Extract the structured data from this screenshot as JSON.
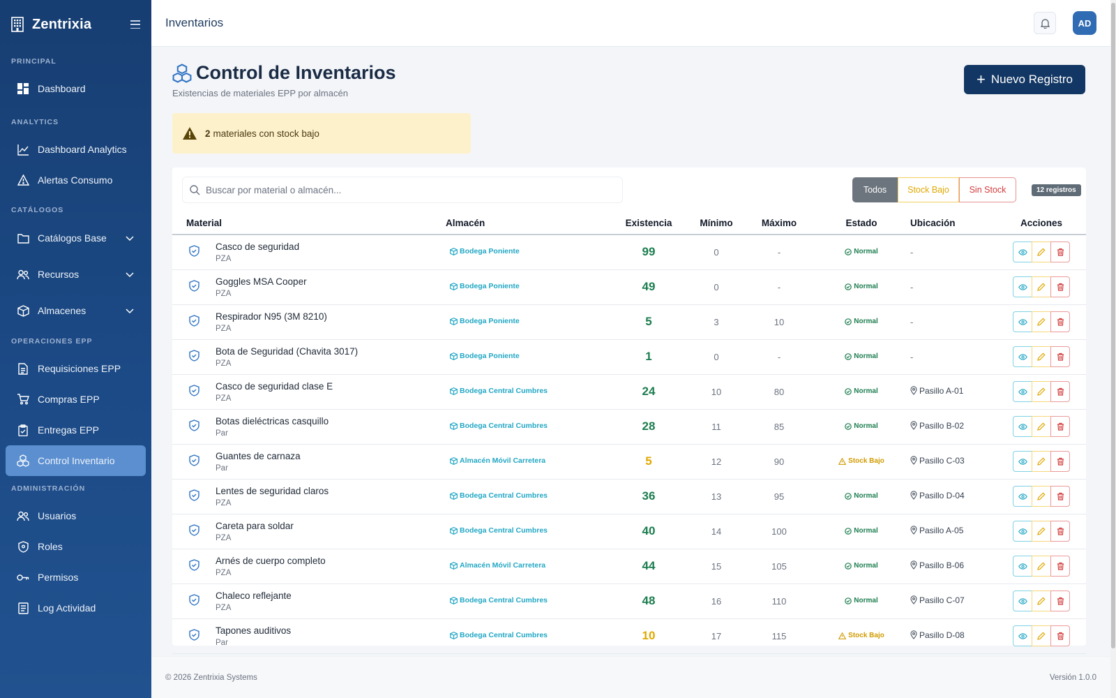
{
  "sidebar": {
    "brand": "Zentrixia",
    "sections": {
      "principal": "PRINCIPAL",
      "analytics": "ANALYTICS",
      "catalogos": "CATÁLOGOS",
      "operaciones": "OPERACIONES EPP",
      "administracion": "ADMINISTRACIÓN"
    },
    "items": {
      "dashboard": "Dashboard",
      "dashboard_analytics": "Dashboard Analytics",
      "alertas_consumo": "Alertas Consumo",
      "catalogos_base": "Catálogos Base",
      "recursos": "Recursos",
      "almacenes": "Almacenes",
      "requisiciones": "Requisiciones EPP",
      "compras": "Compras EPP",
      "entregas": "Entregas EPP",
      "control_inventario": "Control Inventario",
      "usuarios": "Usuarios",
      "roles": "Roles",
      "permisos": "Permisos",
      "log_actividad": "Log Actividad"
    },
    "active_item": "control_inventario"
  },
  "header": {
    "title": "Inventarios",
    "avatar_initials": "AD"
  },
  "page": {
    "title": "Control de Inventarios",
    "subtitle": "Existencias de materiales EPP por almacén",
    "new_button": "Nuevo Registro",
    "alert": {
      "count": "2",
      "text": "materiales con stock bajo"
    }
  },
  "toolbar": {
    "search_placeholder": "Buscar por material o almacén...",
    "filters": {
      "all": "Todos",
      "low": "Stock Bajo",
      "none": "Sin Stock"
    },
    "records_badge": "12 registros"
  },
  "table": {
    "headers": {
      "material": "Material",
      "almacen": "Almacén",
      "existencia": "Existencia",
      "minimo": "Mínimo",
      "maximo": "Máximo",
      "estado": "Estado",
      "ubicacion": "Ubicación",
      "acciones": "Acciones"
    },
    "rows": [
      {
        "material": "Casco de seguridad",
        "unidad": "PZA",
        "almacen": "Bodega Poniente",
        "existencia": "99",
        "minimo": "0",
        "maximo": "-",
        "estado": "Normal",
        "estado_tipo": "normal",
        "ubicacion": "-"
      },
      {
        "material": "Goggles MSA Cooper",
        "unidad": "PZA",
        "almacen": "Bodega Poniente",
        "existencia": "49",
        "minimo": "0",
        "maximo": "-",
        "estado": "Normal",
        "estado_tipo": "normal",
        "ubicacion": "-"
      },
      {
        "material": "Respirador N95 (3M 8210)",
        "unidad": "PZA",
        "almacen": "Bodega Poniente",
        "existencia": "5",
        "minimo": "3",
        "maximo": "10",
        "estado": "Normal",
        "estado_tipo": "normal",
        "ubicacion": "-"
      },
      {
        "material": "Bota de Seguridad (Chavita 3017)",
        "unidad": "PZA",
        "almacen": "Bodega Poniente",
        "existencia": "1",
        "minimo": "0",
        "maximo": "-",
        "estado": "Normal",
        "estado_tipo": "normal",
        "ubicacion": "-"
      },
      {
        "material": "Casco de seguridad clase E",
        "unidad": "PZA",
        "almacen": "Bodega Central Cumbres",
        "existencia": "24",
        "minimo": "10",
        "maximo": "80",
        "estado": "Normal",
        "estado_tipo": "normal",
        "ubicacion": "Pasillo A-01"
      },
      {
        "material": "Botas dieléctricas casquillo",
        "unidad": "Par",
        "almacen": "Bodega Central Cumbres",
        "existencia": "28",
        "minimo": "11",
        "maximo": "85",
        "estado": "Normal",
        "estado_tipo": "normal",
        "ubicacion": "Pasillo B-02"
      },
      {
        "material": "Guantes de carnaza",
        "unidad": "Par",
        "almacen": "Almacén Móvil Carretera",
        "existencia": "5",
        "minimo": "12",
        "maximo": "90",
        "estado": "Stock Bajo",
        "estado_tipo": "low",
        "ubicacion": "Pasillo C-03"
      },
      {
        "material": "Lentes de seguridad claros",
        "unidad": "PZA",
        "almacen": "Bodega Central Cumbres",
        "existencia": "36",
        "minimo": "13",
        "maximo": "95",
        "estado": "Normal",
        "estado_tipo": "normal",
        "ubicacion": "Pasillo D-04"
      },
      {
        "material": "Careta para soldar",
        "unidad": "PZA",
        "almacen": "Bodega Central Cumbres",
        "existencia": "40",
        "minimo": "14",
        "maximo": "100",
        "estado": "Normal",
        "estado_tipo": "normal",
        "ubicacion": "Pasillo A-05"
      },
      {
        "material": "Arnés de cuerpo completo",
        "unidad": "PZA",
        "almacen": "Almacén Móvil Carretera",
        "existencia": "44",
        "minimo": "15",
        "maximo": "105",
        "estado": "Normal",
        "estado_tipo": "normal",
        "ubicacion": "Pasillo B-06"
      },
      {
        "material": "Chaleco reflejante",
        "unidad": "PZA",
        "almacen": "Bodega Central Cumbres",
        "existencia": "48",
        "minimo": "16",
        "maximo": "110",
        "estado": "Normal",
        "estado_tipo": "normal",
        "ubicacion": "Pasillo C-07"
      },
      {
        "material": "Tapones auditivos",
        "unidad": "Par",
        "almacen": "Bodega Central Cumbres",
        "existencia": "10",
        "minimo": "17",
        "maximo": "115",
        "estado": "Stock Bajo",
        "estado_tipo": "low",
        "ubicacion": "Pasillo D-08"
      }
    ]
  },
  "footer": {
    "copyright": "© 2026 Zentrixia Systems",
    "version": "Versión 1.0.0"
  },
  "colors": {
    "sidebar": "#173e72",
    "active": "#5b8fd0",
    "primary_button": "#133764",
    "ok": "#1c7d4f",
    "low": "#e0a800",
    "danger": "#d33b3b",
    "info": "#22a7c4"
  },
  "icons": {
    "dashboard": "grid-icon",
    "analytics": "line-chart-icon",
    "alertas": "warning-triangle-icon",
    "catalogos": "folder-icon",
    "recursos": "users-icon",
    "almacenes": "box-icon",
    "requisiciones": "document-icon",
    "compras": "cart-icon",
    "entregas": "clipboard-icon",
    "inventario": "boxes-icon",
    "usuarios": "users-icon",
    "roles": "shield-icon",
    "permisos": "key-icon",
    "log": "list-icon"
  }
}
